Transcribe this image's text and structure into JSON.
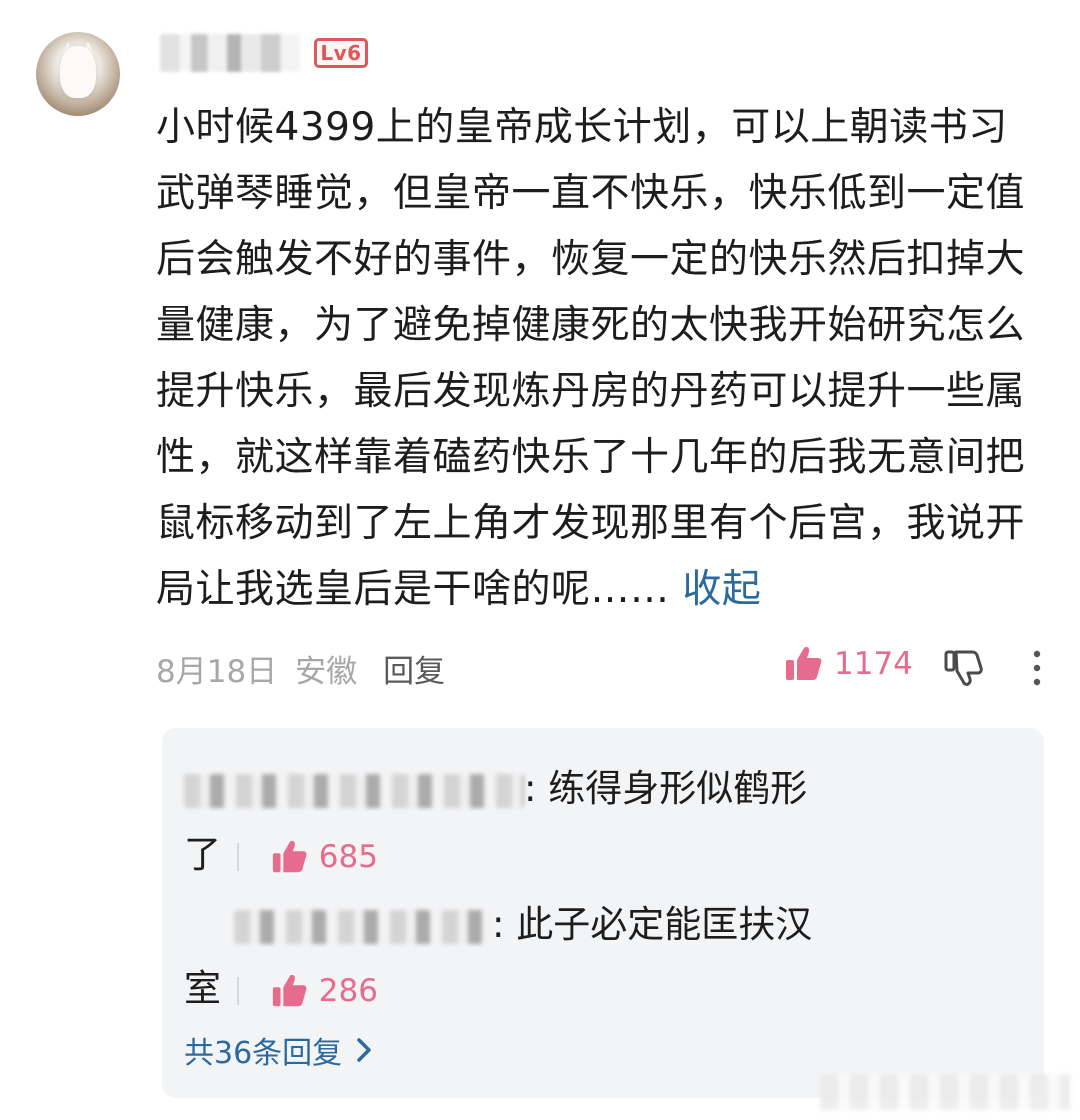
{
  "comment": {
    "level_badge": "Lv6",
    "text": "小时候4399上的皇帝成长计划，可以上朝读书习武弹琴睡觉，但皇帝一直不快乐，快乐低到一定值后会触发不好的事件，恢复一定的快乐然后扣掉大量健康，为了避免掉健康死的太快我开始研究怎么提升快乐，最后发现炼丹房的丹药可以提升一些属性，就这样靠着磕药快乐了十几年的后我无意间把鼠标移动到了左上角才发现那里有个后宫，我说开局让我选皇后是干啥的呢……",
    "collapse_label": "收起",
    "date": "8月18日",
    "location": "安徽",
    "reply_label": "回复",
    "likes": "1174",
    "like_icon": "thumbs-up-icon",
    "dislike_icon": "thumbs-down-icon",
    "more_icon": "more-vertical-icon"
  },
  "replies": {
    "items": [
      {
        "text_line1": ": 练得身形似鹤形",
        "text_line2": "了",
        "likes": "685"
      },
      {
        "text_line1": ":  此子必定能匡扶汉",
        "text_line2": "室",
        "likes": "286"
      }
    ],
    "see_all_label": "共36条回复",
    "see_all_icon": "chevron-right-icon"
  },
  "colors": {
    "like": "#e76b8c",
    "link": "#2b6a9e",
    "level_badge": "#e0575b",
    "reply_bg": "#f3f4f6"
  }
}
